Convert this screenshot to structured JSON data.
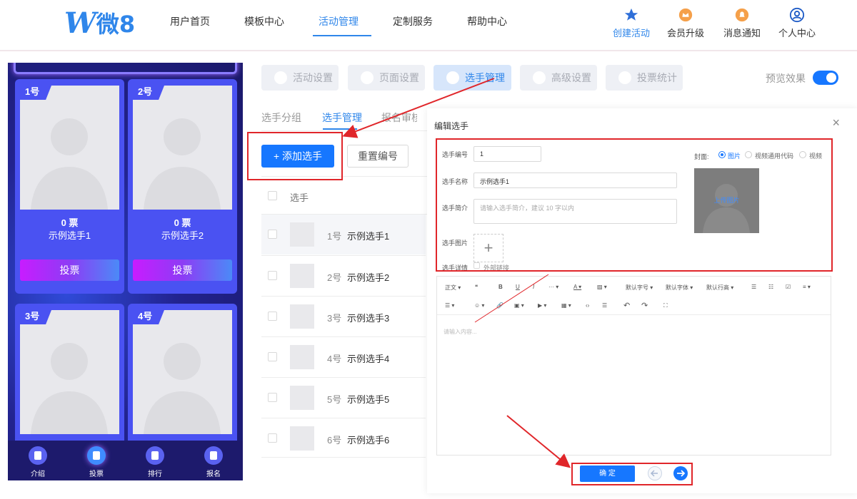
{
  "logo": {
    "w": "W",
    "text": "微8"
  },
  "nav": {
    "items": [
      {
        "label": "用户首页",
        "name": "nav-home"
      },
      {
        "label": "模板中心",
        "name": "nav-templates"
      },
      {
        "label": "活动管理",
        "name": "nav-activity",
        "active": true
      },
      {
        "label": "定制服务",
        "name": "nav-custom"
      },
      {
        "label": "帮助中心",
        "name": "nav-help"
      }
    ],
    "tools": [
      {
        "label": "创建活动",
        "icon": "star-icon"
      },
      {
        "label": "会员升级",
        "icon": "vip-crown-icon"
      },
      {
        "label": "消息通知",
        "icon": "bell-icon"
      },
      {
        "label": "个人中心",
        "icon": "user-icon"
      }
    ]
  },
  "phone": {
    "cards": [
      {
        "num": "1号",
        "votes": "0 票",
        "name": "示例选手1",
        "vote_btn": "投票"
      },
      {
        "num": "2号",
        "votes": "0 票",
        "name": "示例选手2",
        "vote_btn": "投票"
      },
      {
        "num": "3号",
        "votes": "",
        "name": "",
        "vote_btn": ""
      },
      {
        "num": "4号",
        "votes": "",
        "name": "",
        "vote_btn": ""
      }
    ],
    "tabs": [
      {
        "label": "介绍",
        "icon": "intro-icon"
      },
      {
        "label": "投票",
        "icon": "vote-icon"
      },
      {
        "label": "排行",
        "icon": "rank-icon"
      },
      {
        "label": "报名",
        "icon": "signup-icon"
      }
    ]
  },
  "tabs": [
    {
      "label": "活动设置",
      "icon": "heart-icon"
    },
    {
      "label": "页面设置",
      "icon": "page-icon"
    },
    {
      "label": "选手管理",
      "icon": "contestant-icon",
      "active": true
    },
    {
      "label": "高级设置",
      "icon": "advanced-icon"
    },
    {
      "label": "投票统计",
      "icon": "stats-icon"
    }
  ],
  "preview": {
    "label": "预览效果",
    "on": true
  },
  "subtabs": [
    {
      "label": "选手分组"
    },
    {
      "label": "选手管理",
      "active": true
    },
    {
      "label": "报名审核"
    }
  ],
  "buttons": {
    "add": "+ 添加选手",
    "reset": "重置编号"
  },
  "list": {
    "header": "选手",
    "rows": [
      {
        "num": "1号",
        "name": "示例选手1"
      },
      {
        "num": "2号",
        "name": "示例选手2"
      },
      {
        "num": "3号",
        "name": "示例选手3"
      },
      {
        "num": "4号",
        "name": "示例选手4"
      },
      {
        "num": "5号",
        "name": "示例选手5"
      },
      {
        "num": "6号",
        "name": "示例选手6"
      }
    ]
  },
  "modal": {
    "title": "编辑选手",
    "close": "×",
    "fields": {
      "number_label": "选手编号",
      "number_value": "1",
      "name_label": "选手名称",
      "name_value": "示例选手1",
      "intro_label": "选手简介",
      "intro_placeholder": "请输入选手简介，建议 10 字以内",
      "image_label": "选手图片",
      "detail_label": "选手详情",
      "external_link": "外部链接"
    },
    "cover": {
      "label": "封面:",
      "options": [
        "图片",
        "视频通用代码",
        "视频"
      ],
      "selected": "图片",
      "upload_hint": "上传图片"
    },
    "editor": {
      "toolbar_row1": [
        "正文 ▾",
        "❝",
        "B",
        "U",
        "I",
        "··· ▾",
        "A ▾",
        "▨ ▾",
        "默认字号 ▾",
        "默认字体 ▾",
        "默认行高 ▾",
        "☰",
        "☷",
        "☑",
        "≡ ▾"
      ],
      "toolbar_row2": [
        "☰ ▾",
        "☺ ▾",
        "🔗",
        "▣ ▾",
        "▶ ▾",
        "▦ ▾",
        "‹›",
        "☰",
        "↶",
        "↷",
        "⛶"
      ],
      "placeholder": "请输入内容..."
    },
    "ok": "确 定"
  },
  "colors": {
    "primary": "#1677ff",
    "accent_red": "#e0262a",
    "phone_bg": "#22238f"
  }
}
